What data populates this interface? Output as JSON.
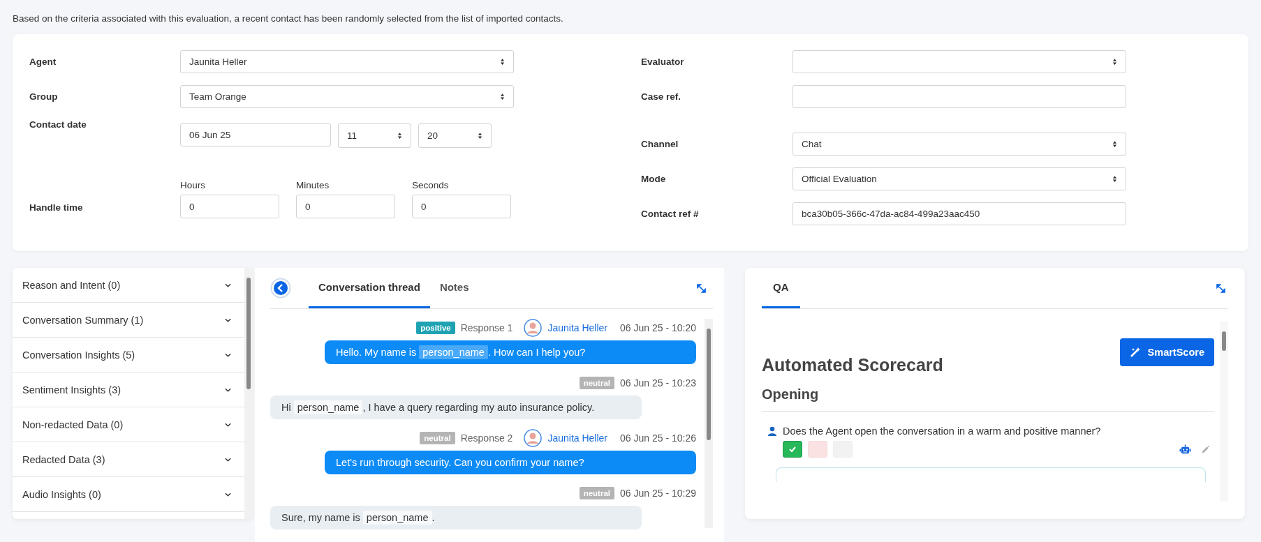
{
  "intro": "Based on the criteria associated with this evaluation, a recent contact has been randomly selected from the list of imported contacts.",
  "form": {
    "left": [
      {
        "kind": "select",
        "label": "Agent",
        "value": "Jaunita Heller"
      },
      {
        "kind": "select",
        "label": "Group",
        "value": "Team Orange"
      },
      {
        "kind": "datetime",
        "label": "Contact date",
        "date": "06 Jun 25",
        "hour": "11",
        "minute": "20"
      },
      {
        "kind": "duration",
        "label": "Handle time",
        "fields": [
          {
            "label": "Hours",
            "value": "0"
          },
          {
            "label": "Minutes",
            "value": "0"
          },
          {
            "label": "Seconds",
            "value": "0"
          }
        ]
      }
    ],
    "right": [
      {
        "kind": "select",
        "label": "Evaluator"
      },
      {
        "kind": "input",
        "label": "Case ref."
      },
      {
        "kind": "select",
        "label": "Channel",
        "value": "Chat"
      },
      {
        "kind": "select",
        "label": "Mode",
        "value": "Official Evaluation"
      },
      {
        "kind": "input",
        "label": "Contact ref #",
        "value": "bca30b05-366c-47da-ac84-499a23aac450"
      }
    ]
  },
  "accordion": [
    {
      "label": "Reason and Intent (0)",
      "expanded": false
    },
    {
      "label": "Conversation Summary (1)",
      "expanded": false
    },
    {
      "label": "Conversation Insights (5)",
      "expanded": false
    },
    {
      "label": "Sentiment Insights (3)",
      "expanded": false
    },
    {
      "label": "Non-redacted Data (0)",
      "expanded": false
    },
    {
      "label": "Redacted Data (3)",
      "expanded": false
    },
    {
      "label": "Audio Insights (0)",
      "expanded": false
    }
  ],
  "conversation": {
    "tabs": [
      {
        "label": "Conversation thread",
        "selected": true
      },
      {
        "label": "Notes",
        "selected": false
      }
    ],
    "messages": [
      {
        "kind": "agent",
        "sentiment": "positive",
        "color": "#1fa3b3",
        "response": "Response 1",
        "author": "Jaunita Heller",
        "time": "06 Jun 25 - 10:20",
        "segments": [
          {
            "text": "Hello. My name is ",
            "redacted": false
          },
          {
            "text": "person_name",
            "redacted": true
          },
          {
            "text": ". How can I help you?",
            "redacted": false
          }
        ]
      },
      {
        "kind": "customer",
        "sentiment": "neutral",
        "color": "#b4b4b4",
        "time": "06 Jun 25 - 10:23",
        "segments": [
          {
            "text": "Hi ",
            "redacted": false
          },
          {
            "text": "person_name",
            "redacted": true
          },
          {
            "text": ", I have a query regarding my auto insurance policy.",
            "redacted": false
          }
        ]
      },
      {
        "kind": "agent",
        "sentiment": "neutral",
        "color": "#b4b4b4",
        "response": "Response 2",
        "author": "Jaunita Heller",
        "time": "06 Jun 25 - 10:26",
        "segments": [
          {
            "text": "Let's run through security. Can you confirm your name?",
            "redacted": false
          }
        ]
      },
      {
        "kind": "customer",
        "sentiment": "neutral",
        "color": "#b4b4b4",
        "time": "06 Jun 25 - 10:29",
        "segments": [
          {
            "text": "Sure, my name is ",
            "redacted": false
          },
          {
            "text": "person_name",
            "redacted": true
          },
          {
            "text": ".",
            "redacted": false
          }
        ]
      }
    ]
  },
  "qa": {
    "tabs": [
      {
        "label": "QA",
        "selected": true
      }
    ],
    "button": "SmartScore",
    "title": "Automated Scorecard",
    "section": "Opening",
    "question": "Does the Agent open the conversation in a warm and positive manner?",
    "answers": [
      {
        "kind": "yes",
        "selected": true
      },
      {
        "kind": "no",
        "selected": false
      },
      {
        "kind": "na",
        "selected": false
      }
    ]
  }
}
